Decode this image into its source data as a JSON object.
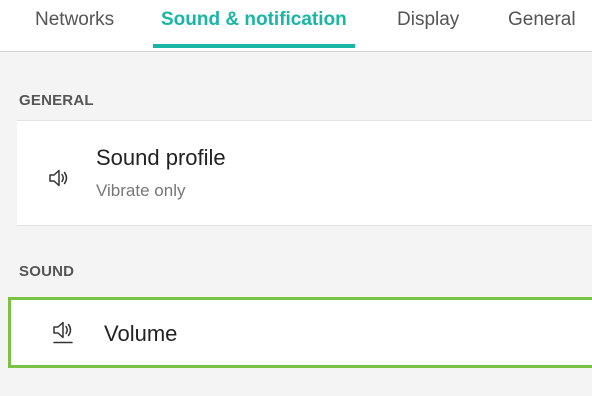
{
  "tabs": [
    {
      "label": "Networks",
      "active": false
    },
    {
      "label": "Sound & notification",
      "active": true
    },
    {
      "label": "Display",
      "active": false
    },
    {
      "label": "General",
      "active": false
    }
  ],
  "sections": {
    "general": {
      "header": "GENERAL",
      "items": [
        {
          "title": "Sound profile",
          "subtitle": "Vibrate only",
          "icon": "speaker-icon"
        }
      ]
    },
    "sound": {
      "header": "SOUND",
      "items": [
        {
          "title": "Volume",
          "icon": "volume-icon",
          "highlighted": true
        }
      ]
    }
  },
  "colors": {
    "accent": "#19b6a6",
    "highlight_border": "#7bc143",
    "background": "#f4f4f4"
  }
}
